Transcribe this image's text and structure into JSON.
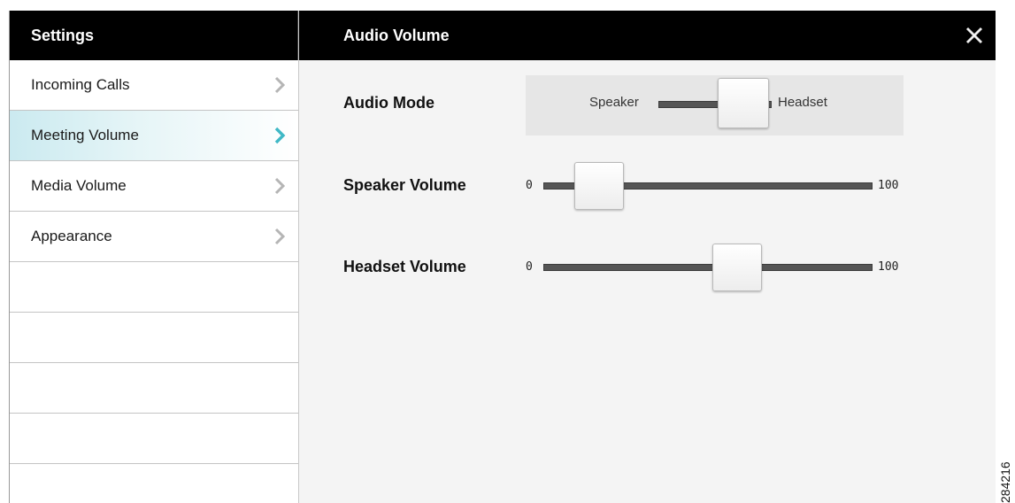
{
  "sidebar": {
    "title": "Settings",
    "items": [
      {
        "label": "Incoming Calls",
        "active": false
      },
      {
        "label": "Meeting Volume",
        "active": true
      },
      {
        "label": "Media Volume",
        "active": false
      },
      {
        "label": "Appearance",
        "active": false
      }
    ]
  },
  "panel": {
    "title": "Audio Volume",
    "audio_mode": {
      "label": "Audio Mode",
      "left_option": "Speaker",
      "right_option": "Headset",
      "selected": "Headset"
    },
    "speaker_volume": {
      "label": "Speaker Volume",
      "min": "0",
      "max": "100",
      "value": 17
    },
    "headset_volume": {
      "label": "Headset Volume",
      "min": "0",
      "max": "100",
      "value": 59
    }
  },
  "figure_id": "284216",
  "colors": {
    "accent": "#3fb8c6",
    "header_bg": "#000000",
    "panel_bg": "#f4f4f4",
    "track": "#555555"
  }
}
